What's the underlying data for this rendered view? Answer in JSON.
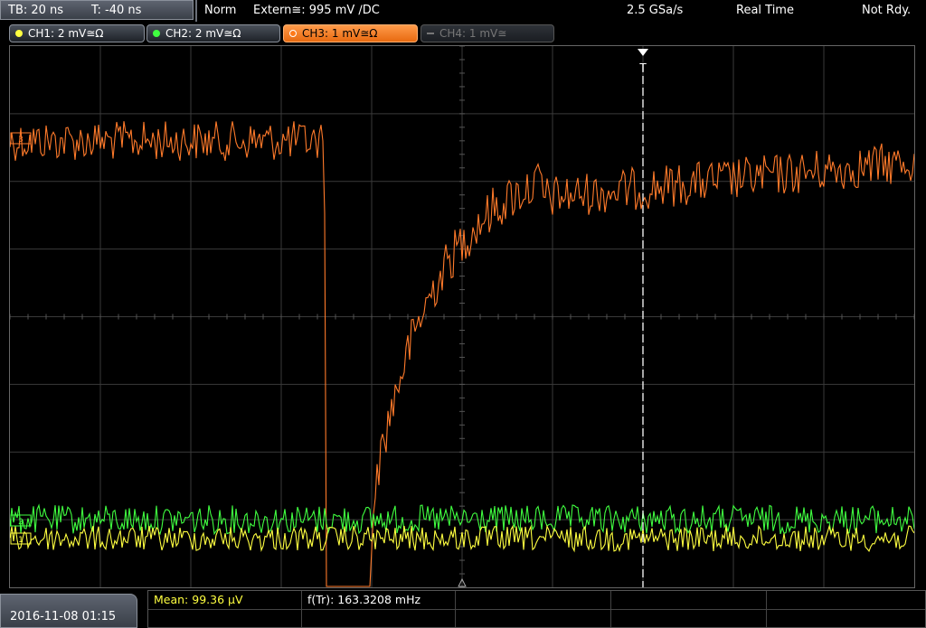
{
  "topbar": {
    "timebase": "TB: 20 ns",
    "trigger_offset": "T: -40 ns",
    "acq_mode": "Norm",
    "trigger_source": "Extern≅: 995 mV ∕DC",
    "sample_rate": "2.5 GSa/s",
    "mode": "Real Time",
    "status": "Not Rdy."
  },
  "channels": [
    {
      "label": "CH1: 2 mV≅Ω",
      "color": "#ffff40",
      "state": "on"
    },
    {
      "label": "CH2: 2 mV≅Ω",
      "color": "#40ff40",
      "state": "on"
    },
    {
      "label": "CH3: 1 mV≅Ω",
      "color": "#ff7a1a",
      "state": "active"
    },
    {
      "label": "CH4: 1 mV≅",
      "color": "#777777",
      "state": "off"
    }
  ],
  "trigger_marker": "T",
  "bottom": {
    "datetime": "2016-11-08 01:15",
    "mean_label": "Mean: 99.36 µV",
    "freq_label": "f(Tr): 163.3208 mHz"
  },
  "colors": {
    "ch1": "#ffff40",
    "ch2": "#40ff40",
    "ch3": "#ff7a2a",
    "grid": "#3a3a3a",
    "trigger": "#ffffff"
  }
}
